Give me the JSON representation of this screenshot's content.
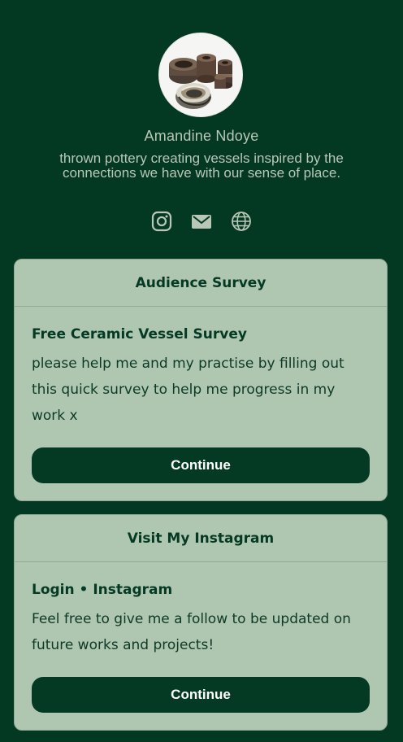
{
  "profile": {
    "name": "Amandine Ndoye",
    "bio": "thrown pottery creating vessels inspired by the connections we have with our sense of place."
  },
  "socials": [
    {
      "icon": "instagram-icon"
    },
    {
      "icon": "email-icon"
    },
    {
      "icon": "website-globe-icon"
    }
  ],
  "cards": [
    {
      "header": "Audience Survey",
      "subtitle": "Free Ceramic Vessel Survey",
      "text": "please help me and my practise by filling out this quick survey to help me progress in my work x",
      "button": "Continue"
    },
    {
      "header": "Visit My Instagram",
      "subtitle": "Login • Instagram",
      "text": "Feel free to give me a follow to be updated on future works and projects!",
      "button": "Continue"
    }
  ],
  "colors": {
    "background": "#033823",
    "card": "#afc6b0",
    "accent": "#043a24",
    "muted_text": "#b9c7b6"
  }
}
